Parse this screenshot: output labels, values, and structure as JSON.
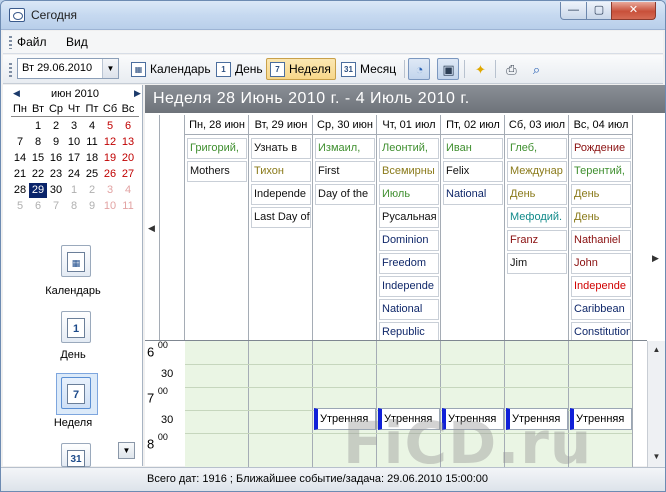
{
  "window": {
    "title": "Сегодня",
    "btn_min": "—",
    "btn_max": "▢",
    "btn_close": "✕"
  },
  "menu": [
    "Файл",
    "Вид"
  ],
  "toolbar": {
    "date_value": "Вт 29.06.2010",
    "btn_calendar": "Календарь",
    "btn_day": "День",
    "btn_week": "Неделя",
    "btn_month": "Месяц"
  },
  "mini_calendar": {
    "month_label": "июн 2010",
    "dow": [
      "Пн",
      "Вт",
      "Ср",
      "Чт",
      "Пт",
      "Сб",
      "Вс"
    ],
    "weeks": [
      [
        "",
        "1",
        "2",
        "3",
        "4",
        "5",
        "6"
      ],
      [
        "7",
        "8",
        "9",
        "10",
        "11",
        "12",
        "13"
      ],
      [
        "14",
        "15",
        "16",
        "17",
        "18",
        "19",
        "20"
      ],
      [
        "21",
        "22",
        "23",
        "24",
        "25",
        "26",
        "27"
      ],
      [
        "28",
        "29",
        "30",
        "1",
        "2",
        "3",
        "4"
      ],
      [
        "5",
        "6",
        "7",
        "8",
        "9",
        "10",
        "11"
      ]
    ]
  },
  "nav": {
    "calendar": "Календарь",
    "day": "День",
    "week": "Неделя",
    "day_icon_num": "1",
    "week_icon_num": "7",
    "month_icon_num": "31"
  },
  "week_header": "Неделя   28 Июнь 2010 г. - 4 Июль 2010 г.",
  "days": [
    {
      "label": "Пн, 28 июн",
      "events": [
        {
          "text": "Григорий,",
          "color": "green"
        },
        {
          "text": "Mothers",
          "color": "black"
        }
      ]
    },
    {
      "label": "Вт, 29 июн",
      "events": [
        {
          "text": "Узнать в",
          "color": "black"
        },
        {
          "text": "Тихон",
          "color": "olive"
        },
        {
          "text": "Independe",
          "color": "black"
        },
        {
          "text": "Last Day of",
          "color": "black"
        }
      ]
    },
    {
      "label": "Ср, 30 июн",
      "events": [
        {
          "text": "Измаил,",
          "color": "green"
        },
        {
          "text": "First",
          "color": "black"
        },
        {
          "text": "Day of the",
          "color": "black"
        }
      ]
    },
    {
      "label": "Чт, 01 июл",
      "events": [
        {
          "text": "Леонтий,",
          "color": "green"
        },
        {
          "text": "Всемирны",
          "color": "olive"
        },
        {
          "text": "Июль",
          "color": "green"
        },
        {
          "text": "Русальная",
          "color": "black"
        },
        {
          "text": "Dominion",
          "color": "navy"
        },
        {
          "text": "Freedom",
          "color": "navy"
        },
        {
          "text": "Independe",
          "color": "navy"
        },
        {
          "text": "National",
          "color": "navy"
        },
        {
          "text": "Republic",
          "color": "navy"
        }
      ]
    },
    {
      "label": "Пт, 02 июл",
      "events": [
        {
          "text": "Иван",
          "color": "green"
        },
        {
          "text": "Felix",
          "color": "black"
        },
        {
          "text": "National",
          "color": "navy"
        }
      ]
    },
    {
      "label": "Сб, 03 июл",
      "events": [
        {
          "text": "Глеб,",
          "color": "green"
        },
        {
          "text": "Междунар",
          "color": "olive"
        },
        {
          "text": "День",
          "color": "olive"
        },
        {
          "text": "Мефодий.",
          "color": "teal"
        },
        {
          "text": "Franz",
          "color": "darkred"
        },
        {
          "text": "Jim",
          "color": "black"
        }
      ]
    },
    {
      "label": "Вс, 04 июл",
      "events": [
        {
          "text": "Рождение",
          "color": "darkred"
        },
        {
          "text": "Терентий,",
          "color": "green"
        },
        {
          "text": "День",
          "color": "olive"
        },
        {
          "text": "День",
          "color": "olive"
        },
        {
          "text": "Nathaniel",
          "color": "darkred"
        },
        {
          "text": "John",
          "color": "darkred"
        },
        {
          "text": "Independe",
          "color": "red"
        },
        {
          "text": "Caribbean",
          "color": "navy"
        },
        {
          "text": "Constitution",
          "color": "navy"
        }
      ]
    }
  ],
  "time_rows": [
    {
      "hour": "6",
      "min": "00"
    },
    {
      "half": "30"
    },
    {
      "hour": "7",
      "min": "00"
    },
    {
      "half": "30"
    },
    {
      "hour": "8",
      "min": "00"
    }
  ],
  "timed_event_label": "Утренняя",
  "status": "Всего дат: 1916 ; Ближайшее событие/задача: 29.06.2010 15:00:00",
  "watermark": "FiCD.ru"
}
